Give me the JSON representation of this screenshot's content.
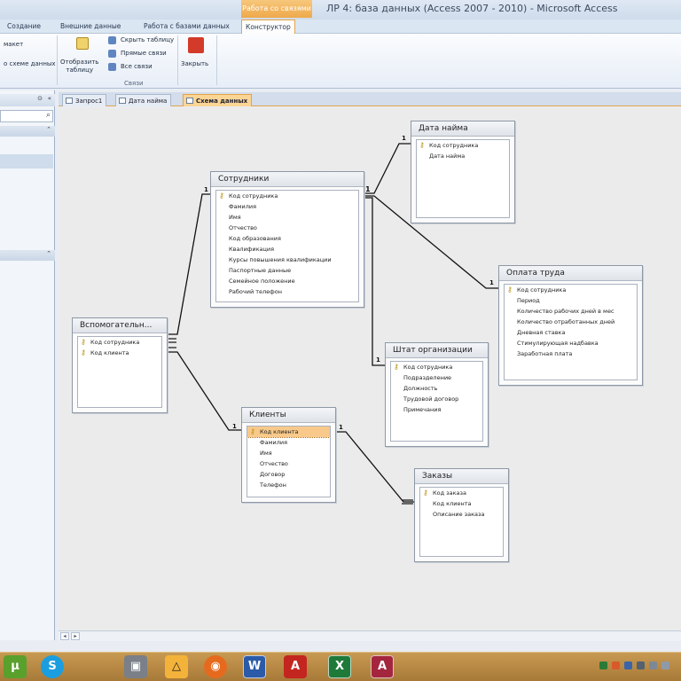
{
  "titlebar": {
    "context_group": "Работа со связями",
    "title": "ЛР 4: база данных (Access 2007 - 2010) - Microsoft Access"
  },
  "ribbon_tabs": [
    {
      "label": "Создание"
    },
    {
      "label": "Внешние данные"
    },
    {
      "label": "Работа с базами данных"
    },
    {
      "label": "Конструктор",
      "active": true
    }
  ],
  "ribbon": {
    "report_label": "Отобразить\nтаблицу",
    "clear_layout_label": "макет",
    "all_relations_prefix_label": "о схеме данных",
    "hide_table_label": "Скрыть таблицу",
    "direct_links_label": "Прямые связи",
    "all_links_label": "Все связи",
    "close_label": "Закрыть",
    "group_label": "Связи"
  },
  "doc_tabs": [
    {
      "label": "Запрос1"
    },
    {
      "label": "Дата найма"
    },
    {
      "label": "Схема данных",
      "active": true
    }
  ],
  "tables": {
    "sotrudniki": {
      "title": "Сотрудники",
      "fields": [
        "Код сотрудника",
        "Фамилия",
        "Имя",
        "Отчество",
        "Код образования",
        "Квалификация",
        "Курсы повышения квалификации",
        "Паспортные данные",
        "Семейное положение",
        "Рабочий телефон"
      ]
    },
    "data_naima": {
      "title": "Дата найма",
      "fields": [
        "Код сотрудника",
        "Дата найма"
      ]
    },
    "oplata": {
      "title": "Оплата труда",
      "fields": [
        "Код сотрудника",
        "Период",
        "Количество рабочих дней в мес",
        "Количество отработанных дней",
        "Дневная ставка",
        "Стимулирующая надбавка",
        "Заработная плата"
      ]
    },
    "shtat": {
      "title": "Штат организации",
      "fields": [
        "Код сотрудника",
        "Подразделение",
        "Должность",
        "Трудовой договор",
        "Примечания"
      ]
    },
    "vspom": {
      "title": "Вспомогательн...",
      "fields": [
        "Код сотрудника",
        "Код клиента"
      ]
    },
    "klienty": {
      "title": "Клиенты",
      "fields": [
        "Код клиента",
        "Фамилия",
        "Имя",
        "Отчество",
        "Договор",
        "Телефон"
      ]
    },
    "zakazy": {
      "title": "Заказы",
      "fields": [
        "Код заказа",
        "Код клиента",
        "Описание заказа"
      ]
    }
  },
  "cardinality": {
    "one": "1",
    "many": "∞"
  },
  "taskbar_items": [
    {
      "name": "utorrent",
      "color": "#5aa02c",
      "glyph": "µ"
    },
    {
      "name": "skype",
      "color": "#1b9ee0",
      "glyph": "S"
    },
    {
      "name": "media",
      "color": "#7a7f88",
      "glyph": "▣"
    },
    {
      "name": "app-triangle",
      "color": "#f3b23a",
      "glyph": "△"
    },
    {
      "name": "firefox",
      "color": "#e66a1e",
      "glyph": "◉"
    },
    {
      "name": "word",
      "color": "#2b5ba8",
      "glyph": "W"
    },
    {
      "name": "acrobat",
      "color": "#c3261f",
      "glyph": "A"
    },
    {
      "name": "excel",
      "color": "#1f7a3a",
      "glyph": "X"
    },
    {
      "name": "access",
      "color": "#a4263e",
      "glyph": "A"
    }
  ]
}
